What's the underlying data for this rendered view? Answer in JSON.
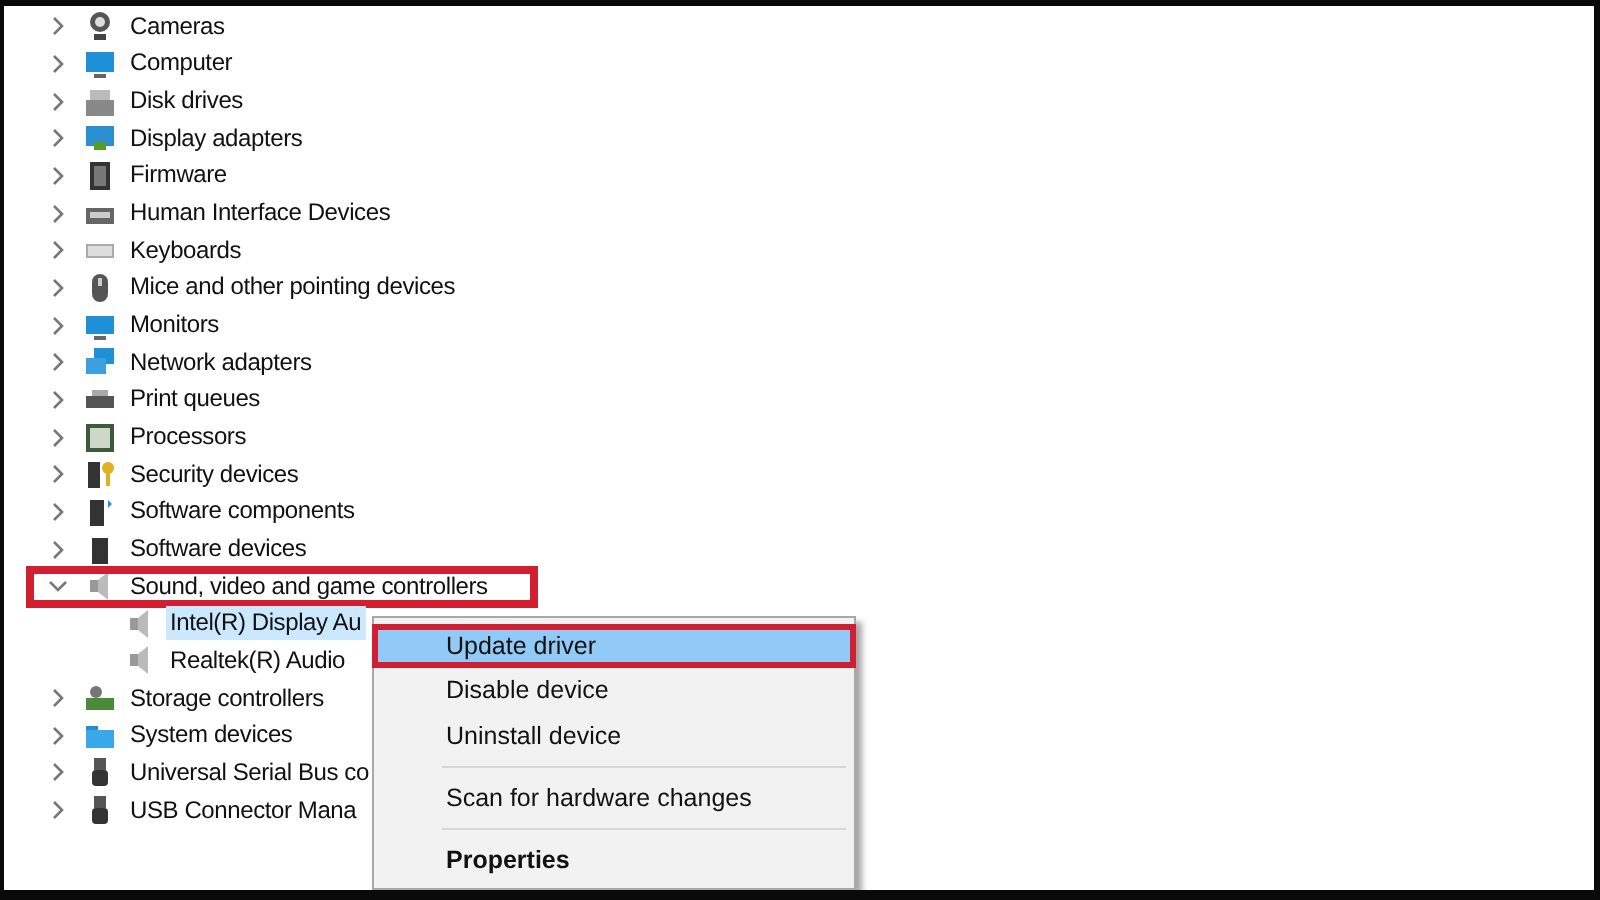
{
  "tree": [
    {
      "label": "Cameras",
      "expanded": false
    },
    {
      "label": "Computer",
      "expanded": false
    },
    {
      "label": "Disk drives",
      "expanded": false
    },
    {
      "label": "Display adapters",
      "expanded": false
    },
    {
      "label": "Firmware",
      "expanded": false
    },
    {
      "label": "Human Interface Devices",
      "expanded": false
    },
    {
      "label": "Keyboards",
      "expanded": false
    },
    {
      "label": "Mice and other pointing devices",
      "expanded": false
    },
    {
      "label": "Monitors",
      "expanded": false
    },
    {
      "label": "Network adapters",
      "expanded": false
    },
    {
      "label": "Print queues",
      "expanded": false
    },
    {
      "label": "Processors",
      "expanded": false
    },
    {
      "label": "Security devices",
      "expanded": false
    },
    {
      "label": "Software components",
      "expanded": false
    },
    {
      "label": "Software devices",
      "expanded": false
    },
    {
      "label": "Sound, video and game controllers",
      "expanded": true,
      "highlighted": true,
      "children": [
        {
          "label": "Intel(R) Display Au",
          "selected": true
        },
        {
          "label": "Realtek(R) Audio",
          "selected": false
        }
      ]
    },
    {
      "label": "Storage controllers",
      "expanded": false
    },
    {
      "label": "System devices",
      "expanded": false
    },
    {
      "label": "Universal Serial Bus co",
      "expanded": false
    },
    {
      "label": "USB Connector Mana",
      "expanded": false
    }
  ],
  "context_menu": [
    {
      "kind": "item",
      "label": "Update driver",
      "selected": true,
      "highlighted": true
    },
    {
      "kind": "item",
      "label": "Disable device",
      "selected": false
    },
    {
      "kind": "item",
      "label": "Uninstall device",
      "selected": false
    },
    {
      "kind": "separator"
    },
    {
      "kind": "item",
      "label": "Scan for hardware changes",
      "selected": false
    },
    {
      "kind": "separator"
    },
    {
      "kind": "item",
      "label": "Properties",
      "selected": false,
      "default": true
    }
  ]
}
